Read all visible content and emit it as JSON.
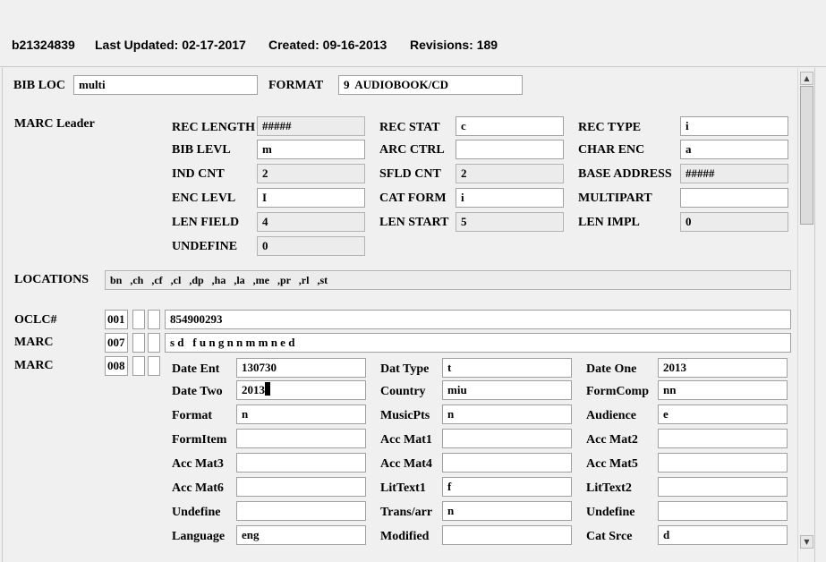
{
  "header": {
    "record_id": "b21324839",
    "last_updated": "Last Updated: 02-17-2017",
    "created": "Created: 09-16-2013",
    "revisions": "Revisions: 189"
  },
  "bib_loc": {
    "label": "BIB LOC",
    "value": "multi"
  },
  "format": {
    "label": "FORMAT",
    "value": "9  AUDIOBOOK/CD"
  },
  "marc_leader": {
    "label": "MARC Leader",
    "fields": [
      {
        "label": "REC LENGTH",
        "value": "#####"
      },
      {
        "label": "REC STAT",
        "value": "c"
      },
      {
        "label": "REC TYPE",
        "value": "i"
      },
      {
        "label": "BIB LEVL",
        "value": "m"
      },
      {
        "label": "ARC CTRL",
        "value": ""
      },
      {
        "label": "CHAR ENC",
        "value": "a"
      },
      {
        "label": "IND CNT",
        "value": "2"
      },
      {
        "label": "SFLD CNT",
        "value": "2"
      },
      {
        "label": "BASE ADDRESS",
        "value": "#####"
      },
      {
        "label": "ENC LEVL",
        "value": "I"
      },
      {
        "label": "CAT FORM",
        "value": "i"
      },
      {
        "label": "MULTIPART",
        "value": ""
      },
      {
        "label": "LEN FIELD",
        "value": "4"
      },
      {
        "label": "LEN START",
        "value": "5"
      },
      {
        "label": "LEN IMPL",
        "value": "0"
      },
      {
        "label": "UNDEFINE",
        "value": "0"
      }
    ]
  },
  "locations": {
    "label": "LOCATIONS",
    "value": "bn   ,ch   ,cf   ,cl   ,dp   ,ha   ,la   ,me   ,pr   ,rl   ,st"
  },
  "oclc": {
    "label": "OCLC#",
    "tag": "001",
    "value": "854900293"
  },
  "marc007": {
    "label": "MARC",
    "tag": "007",
    "value": "s d   f u n g n n m m n e d"
  },
  "marc008": {
    "label": "MARC",
    "tag": "008",
    "fields": [
      {
        "label": "Date Ent",
        "value": "130730"
      },
      {
        "label": "Dat Type",
        "value": "t"
      },
      {
        "label": "Date One",
        "value": "2013"
      },
      {
        "label": "Date Two",
        "value": "2013"
      },
      {
        "label": "Country",
        "value": "miu"
      },
      {
        "label": "FormComp",
        "value": "nn"
      },
      {
        "label": "Format",
        "value": "n"
      },
      {
        "label": "MusicPts",
        "value": "n"
      },
      {
        "label": "Audience",
        "value": "e"
      },
      {
        "label": "FormItem",
        "value": ""
      },
      {
        "label": "Acc Mat1",
        "value": ""
      },
      {
        "label": "Acc Mat2",
        "value": ""
      },
      {
        "label": "Acc Mat3",
        "value": ""
      },
      {
        "label": "Acc Mat4",
        "value": ""
      },
      {
        "label": "Acc Mat5",
        "value": ""
      },
      {
        "label": "Acc Mat6",
        "value": ""
      },
      {
        "label": "LitText1",
        "value": "f"
      },
      {
        "label": "LitText2",
        "value": ""
      },
      {
        "label": "Undefine",
        "value": ""
      },
      {
        "label": "Trans/arr",
        "value": "n"
      },
      {
        "label": "Undefine",
        "value": ""
      },
      {
        "label": "Language",
        "value": "eng"
      },
      {
        "label": "Modified",
        "value": ""
      },
      {
        "label": "Cat Srce",
        "value": "d"
      }
    ]
  },
  "scrollbar": {
    "up_icon": "arrow-up-icon",
    "down_icon": "arrow-down-icon"
  }
}
